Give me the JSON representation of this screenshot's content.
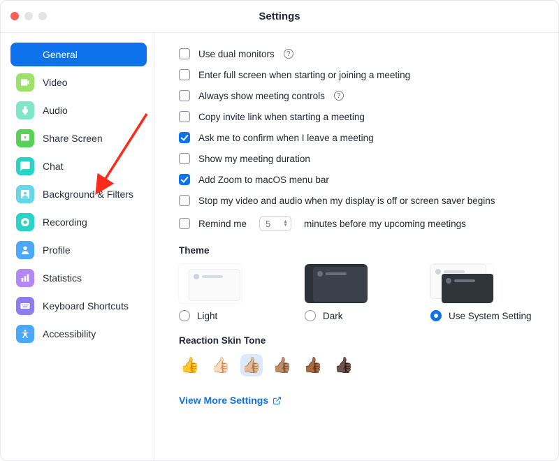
{
  "title": "Settings",
  "sidebar": {
    "items": [
      {
        "label": "General",
        "color": "#0e72ed",
        "active": true
      },
      {
        "label": "Video",
        "color": "#9be26a"
      },
      {
        "label": "Audio",
        "color": "#7fe7c7"
      },
      {
        "label": "Share Screen",
        "color": "#57d257"
      },
      {
        "label": "Chat",
        "color": "#2bd3c7"
      },
      {
        "label": "Background & Filters",
        "color": "#66d6e8"
      },
      {
        "label": "Recording",
        "color": "#2bd3c7"
      },
      {
        "label": "Profile",
        "color": "#4aa8ff"
      },
      {
        "label": "Statistics",
        "color": "#b388f5"
      },
      {
        "label": "Keyboard Shortcuts",
        "color": "#8c7df0"
      },
      {
        "label": "Accessibility",
        "color": "#4aa8ff"
      }
    ]
  },
  "options": [
    {
      "label": "Use dual monitors",
      "checked": false,
      "help": true
    },
    {
      "label": "Enter full screen when starting or joining a meeting",
      "checked": false
    },
    {
      "label": "Always show meeting controls",
      "checked": false,
      "help": true
    },
    {
      "label": "Copy invite link when starting a meeting",
      "checked": false
    },
    {
      "label": "Ask me to confirm when I leave a meeting",
      "checked": true
    },
    {
      "label": "Show my meeting duration",
      "checked": false
    },
    {
      "label": "Add Zoom to macOS menu bar",
      "checked": true
    },
    {
      "label": "Stop my video and audio when my display is off or screen saver begins",
      "checked": false
    }
  ],
  "remind": {
    "prefix": "Remind me",
    "value": "5",
    "suffix": "minutes before my upcoming meetings",
    "checked": false
  },
  "theme": {
    "heading": "Theme",
    "options": [
      {
        "label": "Light",
        "selected": false
      },
      {
        "label": "Dark",
        "selected": false
      },
      {
        "label": "Use System Setting",
        "selected": true
      }
    ]
  },
  "skinTone": {
    "heading": "Reaction Skin Tone",
    "tones": [
      "👍",
      "👍🏻",
      "👍🏼",
      "👍🏽",
      "👍🏾",
      "👍🏿"
    ],
    "selected": 2
  },
  "moreLink": "View More Settings"
}
